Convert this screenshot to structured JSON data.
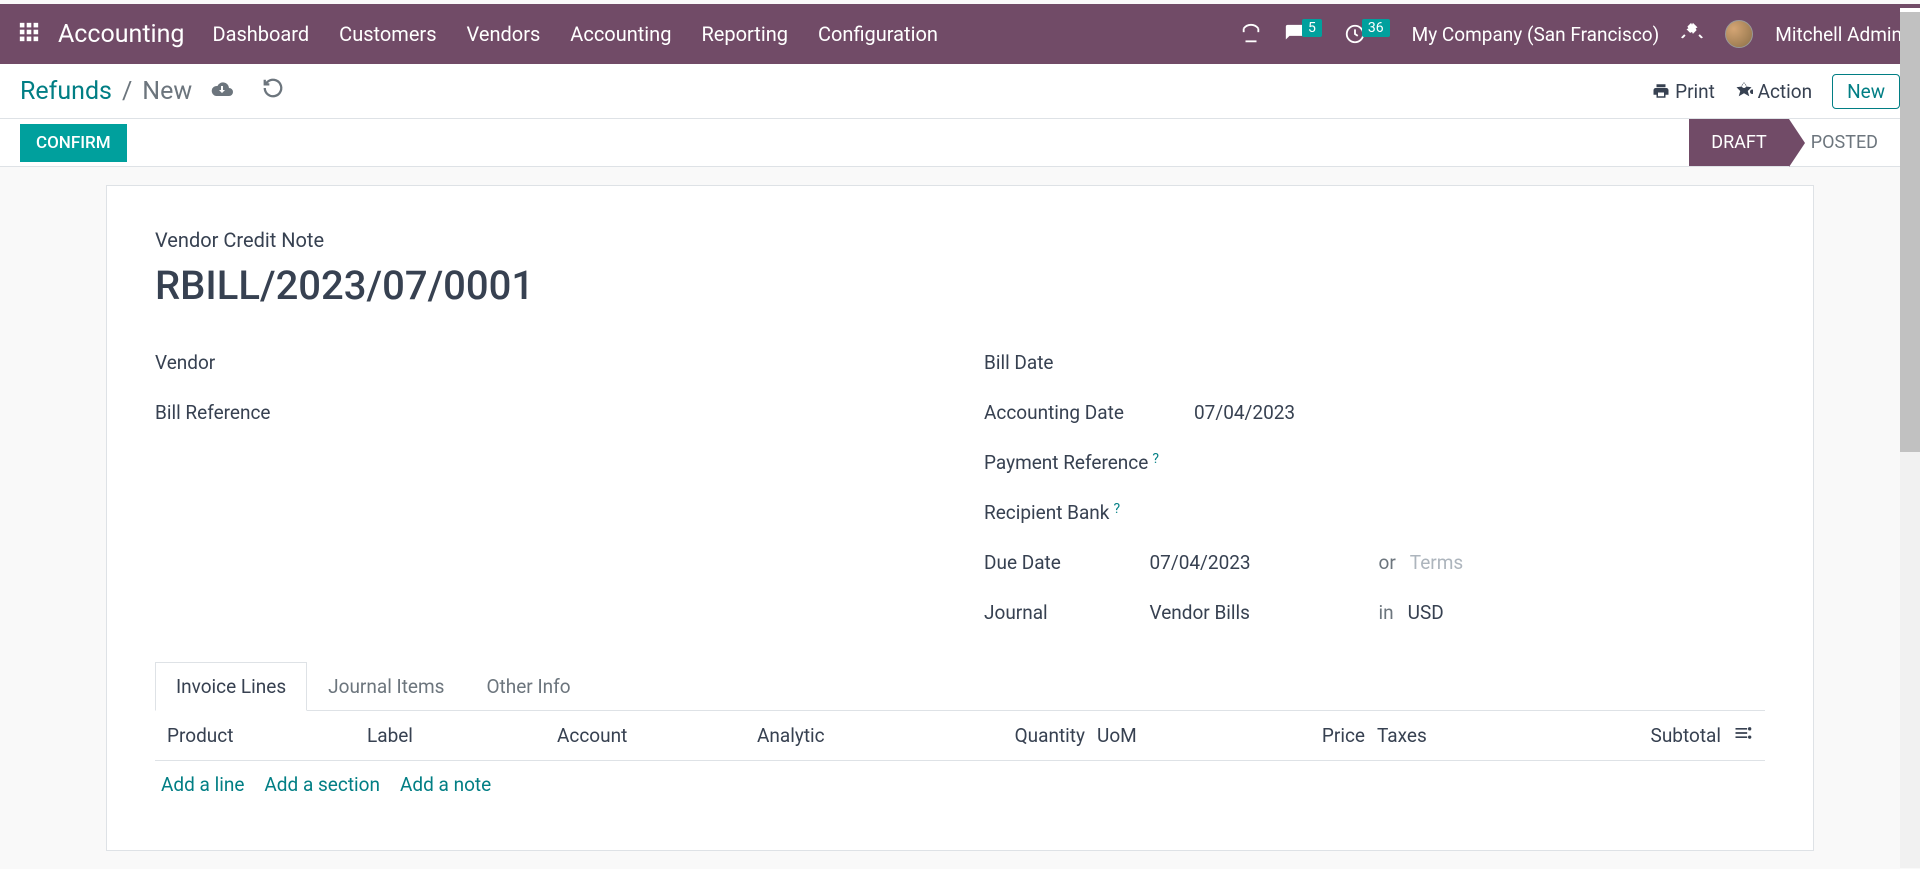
{
  "navbar": {
    "brand": "Accounting",
    "menu": [
      "Dashboard",
      "Customers",
      "Vendors",
      "Accounting",
      "Reporting",
      "Configuration"
    ],
    "messages_count": "5",
    "activities_count": "36",
    "company": "My Company (San Francisco)",
    "user": "Mitchell Admin"
  },
  "breadcrumb": {
    "root": "Refunds",
    "current": "New",
    "print": "Print",
    "action": "Action",
    "new_btn": "New"
  },
  "status": {
    "confirm": "CONFIRM",
    "draft": "DRAFT",
    "posted": "POSTED"
  },
  "doc": {
    "type": "Vendor Credit Note",
    "title": "RBILL/2023/07/0001",
    "labels": {
      "vendor": "Vendor",
      "bill_reference": "Bill Reference",
      "bill_date": "Bill Date",
      "accounting_date": "Accounting Date",
      "payment_reference": "Payment Reference",
      "recipient_bank": "Recipient Bank",
      "due_date": "Due Date",
      "journal": "Journal"
    },
    "values": {
      "accounting_date": "07/04/2023",
      "due_date": "07/04/2023",
      "due_or": "or",
      "terms_placeholder": "Terms",
      "journal": "Vendor Bills",
      "journal_in": "in",
      "currency": "USD"
    }
  },
  "tabs": {
    "invoice_lines": "Invoice Lines",
    "journal_items": "Journal Items",
    "other_info": "Other Info"
  },
  "table": {
    "headers": {
      "product": "Product",
      "label": "Label",
      "account": "Account",
      "analytic": "Analytic",
      "quantity": "Quantity",
      "uom": "UoM",
      "price": "Price",
      "taxes": "Taxes",
      "subtotal": "Subtotal"
    },
    "actions": {
      "add_line": "Add a line",
      "add_section": "Add a section",
      "add_note": "Add a note"
    }
  }
}
